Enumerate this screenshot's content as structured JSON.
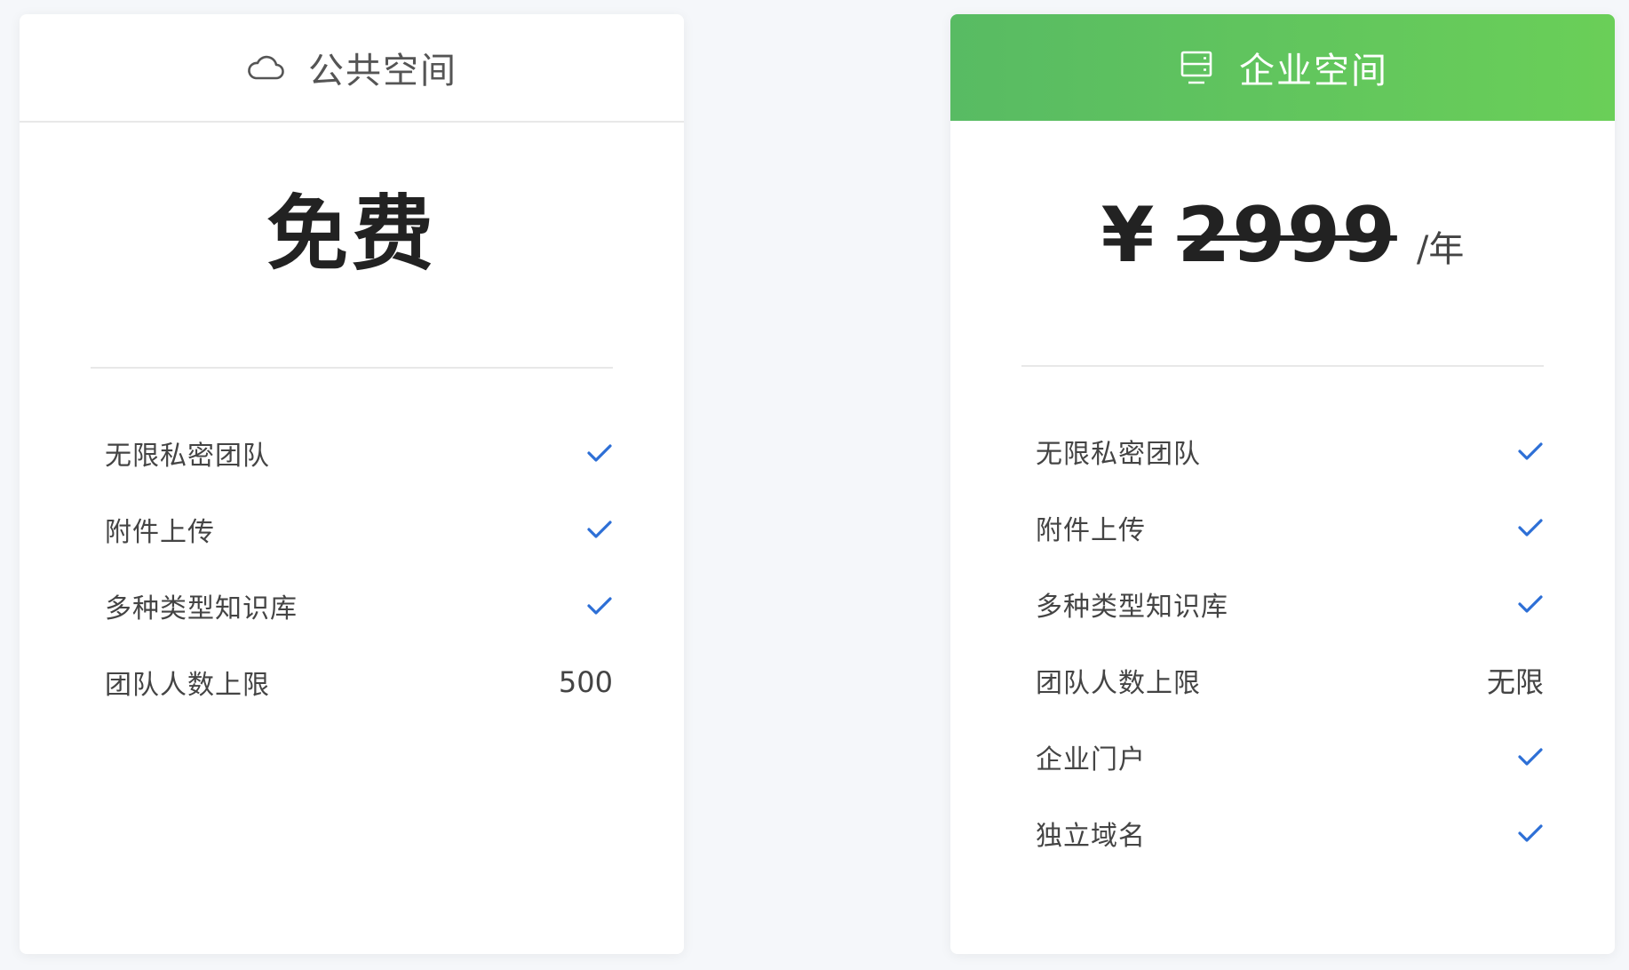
{
  "accent_color": "#2d6fd6",
  "enterprise_header_color": "#5ec45e",
  "public_plan": {
    "header_icon": "cloud-icon",
    "title": "公共空间",
    "price": "免费",
    "features": [
      {
        "label": "无限私密团队",
        "value": null,
        "icon": "check-icon"
      },
      {
        "label": "附件上传",
        "value": null,
        "icon": "check-icon"
      },
      {
        "label": "多种类型知识库",
        "value": null,
        "icon": "check-icon"
      },
      {
        "label": "团队人数上限",
        "value": "500",
        "icon": null
      }
    ]
  },
  "enterprise_plan": {
    "header_icon": "server-icon",
    "title": "企业空间",
    "currency": "¥",
    "price": "2999",
    "price_struck_through": true,
    "price_unit": "/年",
    "features": [
      {
        "label": "无限私密团队",
        "value": null,
        "icon": "check-icon"
      },
      {
        "label": "附件上传",
        "value": null,
        "icon": "check-icon"
      },
      {
        "label": "多种类型知识库",
        "value": null,
        "icon": "check-icon"
      },
      {
        "label": "团队人数上限",
        "value": "无限",
        "icon": null
      },
      {
        "label": "企业门户",
        "value": null,
        "icon": "check-icon"
      },
      {
        "label": "独立域名",
        "value": null,
        "icon": "check-icon"
      }
    ]
  }
}
